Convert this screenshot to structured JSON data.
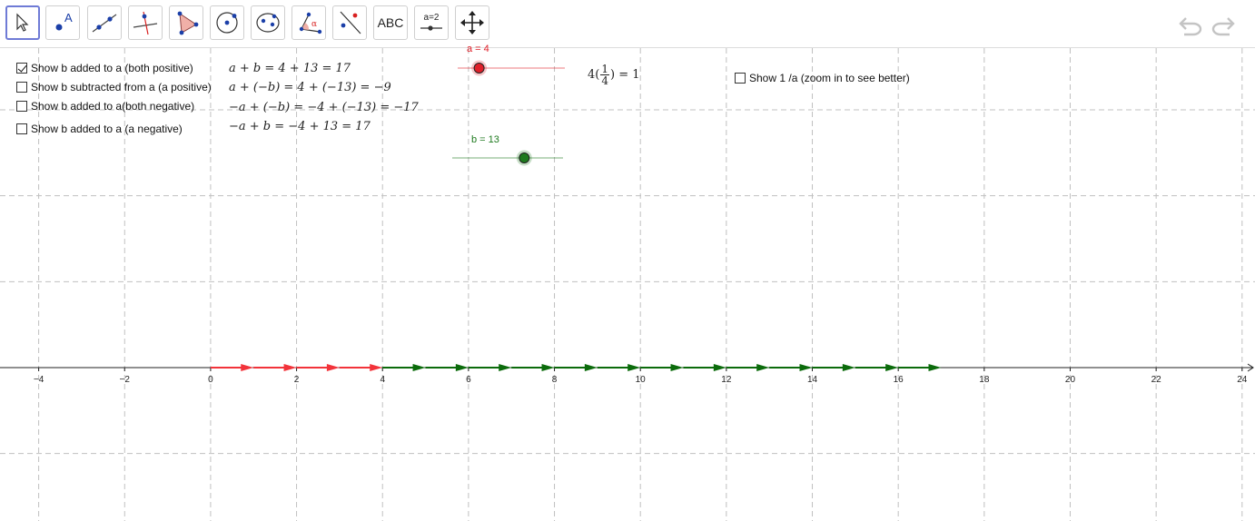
{
  "toolbar": {
    "tools": [
      {
        "name": "move-tool",
        "icon": "pointer-arrow-icon",
        "active": true
      },
      {
        "name": "point-tool",
        "icon": "point-icon",
        "letter": "A"
      },
      {
        "name": "line-tool",
        "icon": "line-through-points-icon"
      },
      {
        "name": "perpendicular-line-tool",
        "icon": "perpendicular-line-icon"
      },
      {
        "name": "polygon-tool",
        "icon": "polygon-icon"
      },
      {
        "name": "circle-tool",
        "icon": "circle-center-point-icon"
      },
      {
        "name": "conic-tool",
        "icon": "ellipse-icon"
      },
      {
        "name": "angle-tool",
        "icon": "angle-icon",
        "letter": "α"
      },
      {
        "name": "reflect-tool",
        "icon": "reflect-about-line-icon"
      },
      {
        "name": "text-tool",
        "icon": "text-icon",
        "label": "ABC"
      },
      {
        "name": "slider-tool",
        "icon": "slider-icon",
        "label": "a=2"
      },
      {
        "name": "move-graphics-view-tool",
        "icon": "move-view-icon"
      }
    ],
    "undo_icon": "undo-icon",
    "redo_icon": "redo-icon"
  },
  "checkboxes": [
    {
      "label": "Show b added to a (both positive)",
      "checked": true,
      "expression": "a + b = 4 + 13 = 17"
    },
    {
      "label": "Show b subtracted from a (a positive)",
      "checked": false,
      "expression": "a + (−b) = 4 + (−13) = −9"
    },
    {
      "label": "Show b added to a(both negative)",
      "checked": false,
      "expression": "−a + (−b) = −4 + (−13) = −17"
    },
    {
      "label": "Show b added to a (a negative)",
      "checked": false,
      "expression": "−a + b = −4 + 13 = 17"
    }
  ],
  "reciprocal": {
    "label": "Show 1 /a (zoom in to see better)",
    "checked": false,
    "expression_prefix": "4(",
    "numerator": "1",
    "denominator": "4",
    "expression_suffix": ") = 1"
  },
  "sliders": {
    "a": {
      "label": "a = 4",
      "value": 4,
      "min": 0,
      "max": 20,
      "color": "#e0202a"
    },
    "b": {
      "label": "b = 13",
      "value": 13,
      "min": 0,
      "max": 20,
      "color": "#1e7a1e"
    }
  },
  "axis": {
    "min": -4.9,
    "max": 24.3,
    "tick_labels": [
      "−4",
      "−2",
      "0",
      "2",
      "4",
      "6",
      "8",
      "10",
      "12",
      "14",
      "16",
      "18",
      "20",
      "22",
      "24"
    ],
    "tick_values": [
      -4,
      -2,
      0,
      2,
      4,
      6,
      8,
      10,
      12,
      14,
      16,
      18,
      20,
      22,
      24
    ]
  },
  "vectors": {
    "a": {
      "from": 0,
      "to": 4,
      "unit_arrows": 4,
      "color": "#f2333a"
    },
    "b": {
      "from": 4,
      "to": 17,
      "unit_arrows": 13,
      "color": "#0b6b0b"
    }
  },
  "colors": {
    "grid": "#c0c0c0",
    "axis": "#222222",
    "accent": "#6f7bd6"
  }
}
